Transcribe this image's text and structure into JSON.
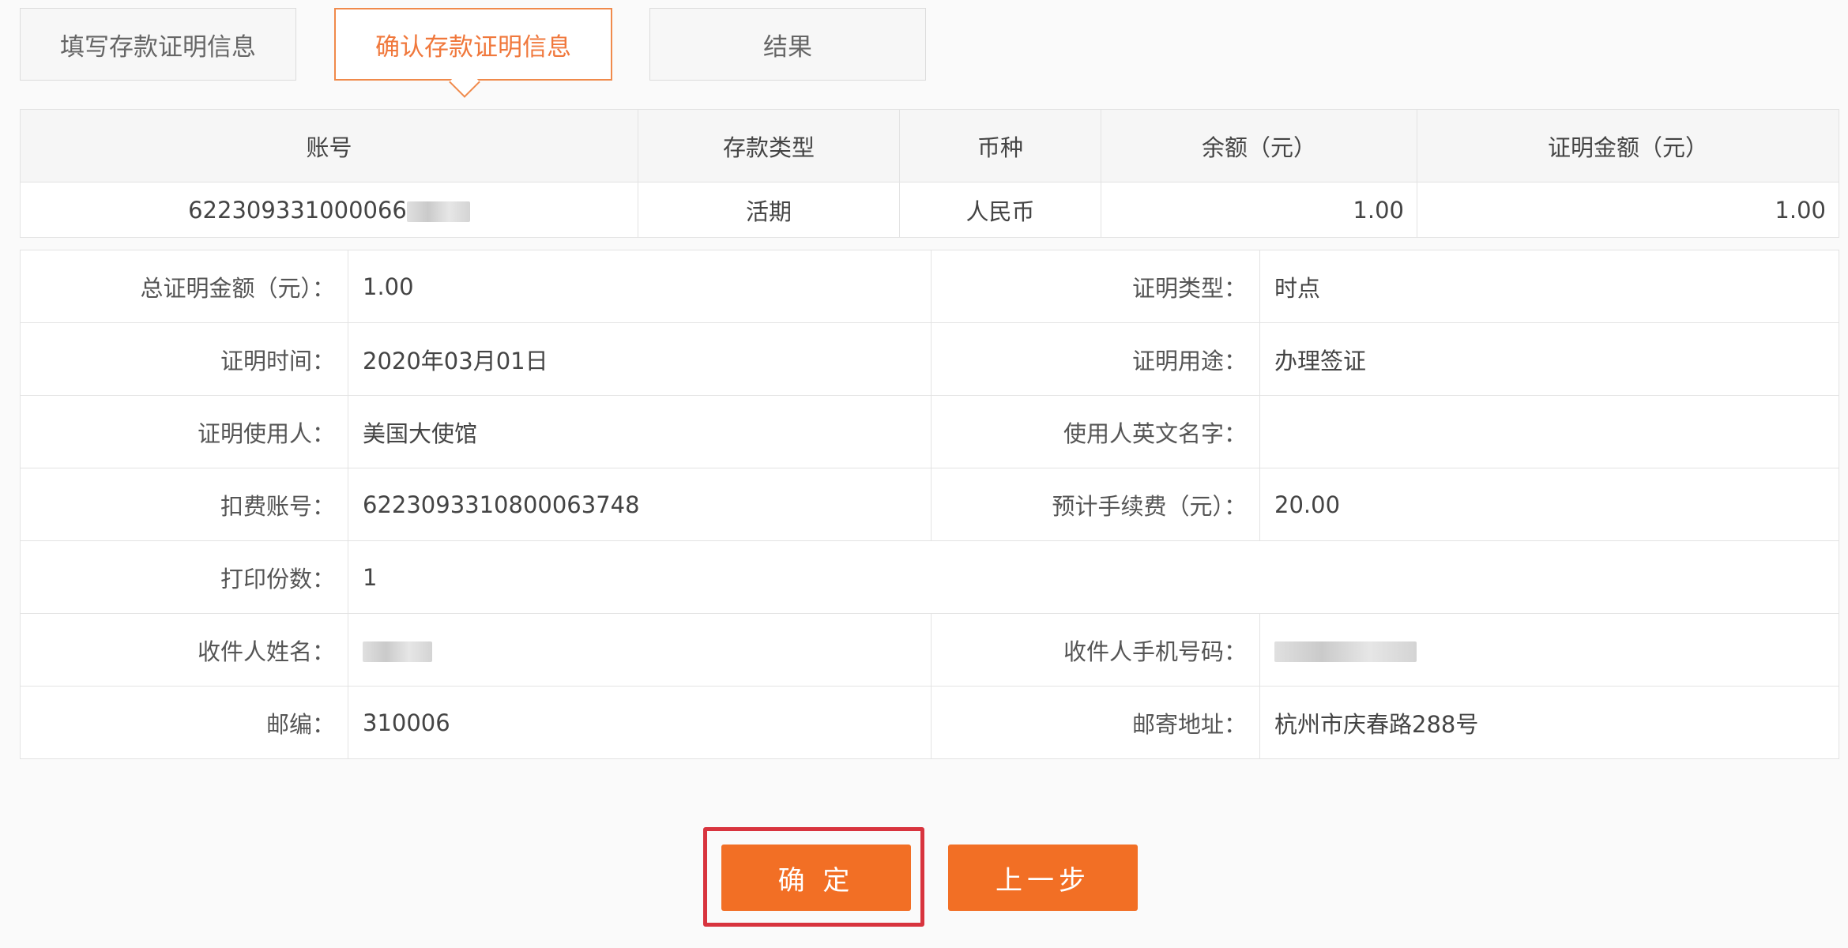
{
  "tabs": [
    {
      "label": "填写存款证明信息"
    },
    {
      "label": "确认存款证明信息"
    },
    {
      "label": "结果"
    }
  ],
  "account_table": {
    "headers": [
      "账号",
      "存款类型",
      "币种",
      "余额（元）",
      "证明金额（元）"
    ],
    "row": {
      "account": "622309331000066",
      "deposit_type": "活期",
      "currency": "人民币",
      "balance": "1.00",
      "certified_amount": "1.00"
    }
  },
  "info": {
    "total_amount_label": "总证明金额（元）：",
    "total_amount": "1.00",
    "cert_type_label": "证明类型：",
    "cert_type": "时点",
    "cert_time_label": "证明时间：",
    "cert_time": "2020年03月01日",
    "cert_purpose_label": "证明用途：",
    "cert_purpose": "办理签证",
    "cert_user_label": "证明使用人：",
    "cert_user": "美国大使馆",
    "user_en_name_label": "使用人英文名字：",
    "user_en_name": "",
    "fee_account_label": "扣费账号：",
    "fee_account": "6223093310800063748",
    "est_fee_label": "预计手续费（元）：",
    "est_fee": "20.00",
    "copies_label": "打印份数：",
    "copies": "1",
    "recipient_name_label": "收件人姓名：",
    "recipient_phone_label": "收件人手机号码：",
    "postcode_label": "邮编：",
    "postcode": "310006",
    "address_label": "邮寄地址：",
    "address": "杭州市庆春路288号"
  },
  "buttons": {
    "confirm": "确 定",
    "back": "上一步"
  },
  "colors": {
    "accent": "#f26f25",
    "highlight": "#d8343e"
  }
}
